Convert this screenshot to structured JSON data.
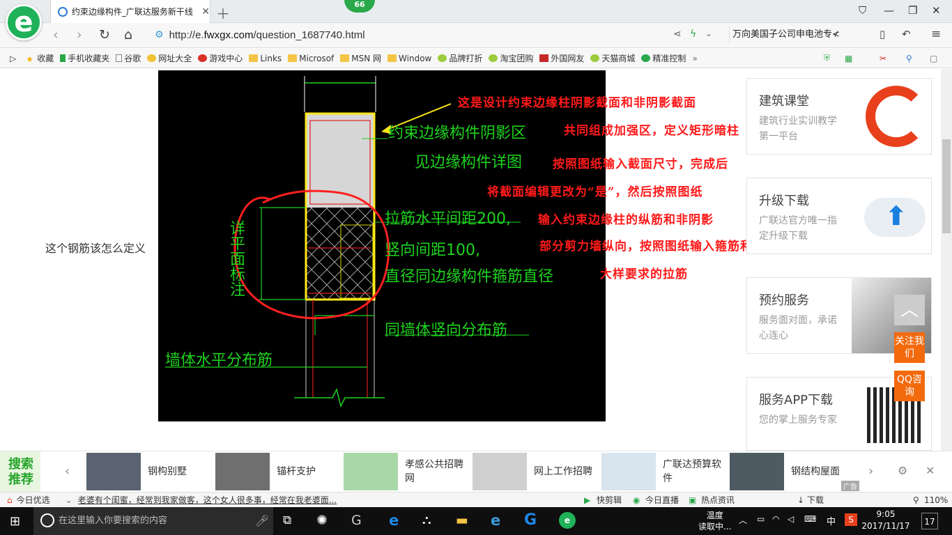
{
  "browser": {
    "tab_title": "约束边缘构件_广联达服务新干线",
    "badge_value": "66",
    "url_prefix": "http://e.",
    "url_host": "fwxgx.com",
    "url_path": "/question_1687740.html",
    "search_text": "万向美国子公司申电池专≮"
  },
  "bookmarks": [
    "收藏",
    "手机收藏夹",
    "谷歌",
    "网址大全",
    "游戏中心",
    "Links",
    "Microsof",
    "MSN 网",
    "Window",
    "品牌打折",
    "淘宝团购",
    "外国网友",
    "天猫商城",
    "精准控制"
  ],
  "page": {
    "question": "这个钢筋该怎么定义"
  },
  "cad": {
    "green_labels": [
      "约束边缘构件阴影区",
      "见边缘构件详图",
      "拉筋水平间距200,",
      "竖向间距100,",
      "直径同边缘构件箍筋直径",
      "同墙体竖向分布筋",
      "墙体水平分布筋",
      "详平面标注"
    ],
    "red_notes": [
      "这是设计约束边缘柱阴影截面和非阴影截面",
      "共同组成加强区，定义矩形暗柱",
      "按照图纸输入截面尺寸，完成后",
      "将截面编辑更改为“是”，然后按照图纸",
      "输入约束边缘柱的纵筋和非阴影",
      "部分剪力墙纵向，按照图纸输入箍筋和",
      "大样要求的拉筋"
    ]
  },
  "sidebar": {
    "cards": [
      {
        "title": "建筑课堂",
        "sub": "建筑行业实训教学第一平台"
      },
      {
        "title": "升级下载",
        "sub": "广联达官方唯一指定升级下载"
      },
      {
        "title": "预约服务",
        "sub": "服务面对面，承诺心连心"
      },
      {
        "title": "服务APP下载",
        "sub": "您的掌上服务专家"
      }
    ],
    "follow": "关注我们",
    "qq": "QQ咨询"
  },
  "recommend": {
    "badge": "搜索推荐",
    "items": [
      "钢构别墅",
      "锚杆支护",
      "孝感公共招聘网",
      "网上工作招聘",
      "广联达预算软件",
      "钢结构屋面"
    ],
    "ad": "广告"
  },
  "statusbar": {
    "left": "今日优选",
    "news": "老婆有个闺蜜，经常到我家做客，这个女人很多事，经常在我老婆面...",
    "items": [
      "快剪辑",
      "今日直播",
      "热点资讯",
      "下载"
    ],
    "zoom": "110%"
  },
  "taskbar": {
    "search_placeholder": "在这里输入你要搜索的内容",
    "weather_1": "温度",
    "weather_2": "读取中...",
    "ime": "中",
    "time": "9:05",
    "date": "2017/11/17",
    "notif": "17"
  },
  "colors": {
    "cad_green": "#1ed31e",
    "note_red": "#ff1a1a",
    "accent_orange": "#f36a0d"
  }
}
